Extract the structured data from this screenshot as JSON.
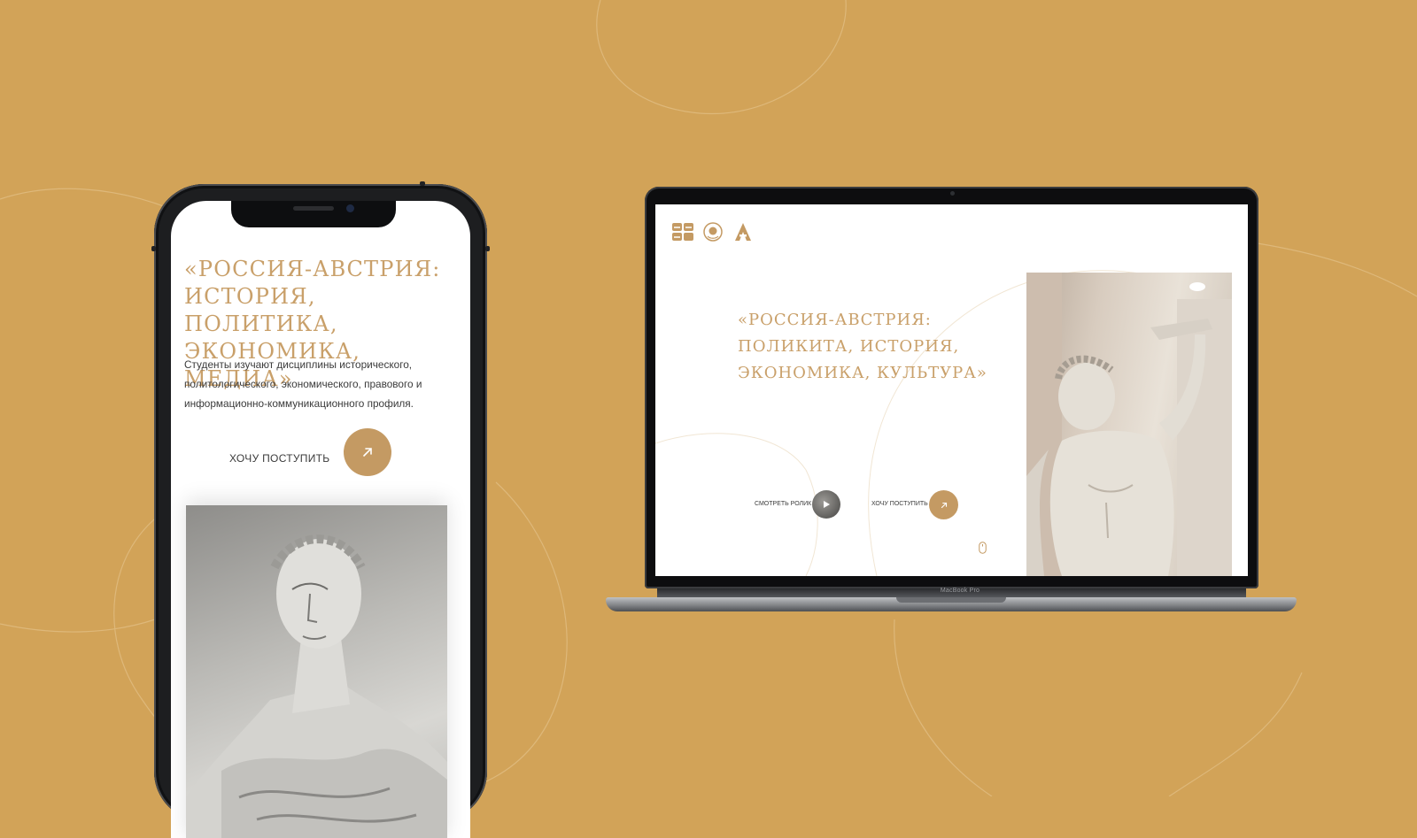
{
  "colors": {
    "background": "#d2a358",
    "accent_gold": "#c49a63",
    "title_gold": "#c9a06a",
    "body_text": "#3a3a3a"
  },
  "mobile": {
    "title": "«РОССИЯ-АВСТРИЯ: ИСТОРИЯ, ПОЛИТИКА, ЭКОНОМИКА, МЕДИА»",
    "description": "Студенты изучают дисциплины исторического, политологического, экономического, правового и информационно-коммуникационного профиля.",
    "cta_label": "ХОЧУ ПОСТУПИТЬ",
    "cta_icon": "arrow-up-right-icon",
    "hero_image": "caesar-bust-statue"
  },
  "desktop": {
    "logos": [
      "university-logo",
      "emblem-logo",
      "letter-a-logo"
    ],
    "title": "«РОССИЯ-АВСТРИЯ: ПОЛИКИТА, ИСТОРИЯ, ЭКОНОМИКА, КУЛЬТУРА»",
    "watch_label": "СМОТРЕТЬ РОЛИК",
    "watch_icon": "play-icon",
    "cta_label": "ХОЧУ ПОСТУПИТЬ",
    "cta_icon": "arrow-up-right-icon",
    "scroll_icon": "mouse-scroll-icon",
    "hero_image": "marble-satyr-statue",
    "device_model": "MacBook Pro"
  }
}
